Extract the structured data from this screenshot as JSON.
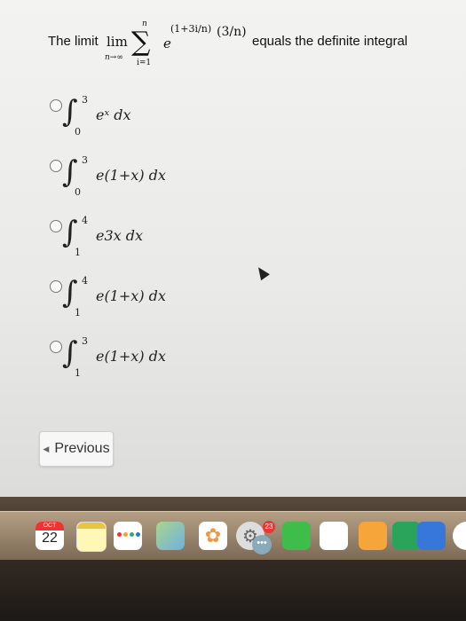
{
  "question": {
    "prefix": "The limit",
    "lim": "lim",
    "lim_sub": "n→∞",
    "sigma": "∑",
    "sigma_top": "n",
    "sigma_bot": "i=1",
    "base": "e",
    "exponent": "(1+3i/n)",
    "fraction": "(3/n)",
    "suffix": "equals the definite integral"
  },
  "options": [
    {
      "upper": "3",
      "lower": "0",
      "integrand": "eˣ dx"
    },
    {
      "upper": "3",
      "lower": "0",
      "integrand": "e(1+x) dx"
    },
    {
      "upper": "4",
      "lower": "1",
      "integrand": "e3x dx"
    },
    {
      "upper": "4",
      "lower": "1",
      "integrand": "e(1+x) dx"
    },
    {
      "upper": "3",
      "lower": "1",
      "integrand": "e(1+x) dx"
    }
  ],
  "navigation": {
    "previous_label": "Previous"
  },
  "dock": {
    "calendar_month": "OCT",
    "calendar_day": "22",
    "settings_badge": "23"
  },
  "colors": {
    "screen_bg": "#efefed",
    "dock_bg": "#5a4c3c",
    "badge": "#e33333"
  }
}
